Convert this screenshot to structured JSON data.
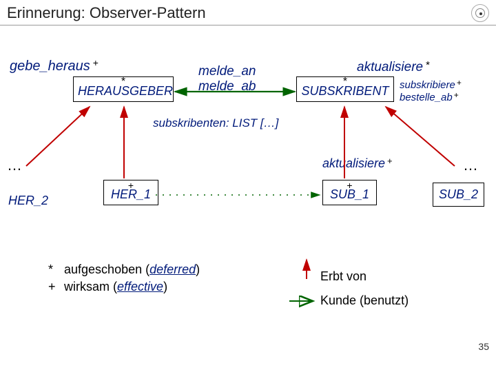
{
  "title": "Erinnerung: Observer-Pattern",
  "labels": {
    "gebe_heraus": "gebe_heraus",
    "melde_an": "melde_an",
    "melde_ab": "melde_ab",
    "aktualisiere_top": "aktualisiere",
    "subskribiere": "subskribiere",
    "bestelle_ab": "bestelle_ab",
    "subskribenten": "subskribenten: LIST […]",
    "aktualisiere_mid": "aktualisiere",
    "dots_left": "…",
    "dots_right": "…"
  },
  "classes": {
    "herausgeber": "HERAUSGEBER",
    "subskribent": "SUBSKRIBENT",
    "her1": "HER_1",
    "her2": "HER_2",
    "sub1": "SUB_1",
    "sub2": "SUB_2"
  },
  "marks": {
    "star": "*",
    "plus": "+"
  },
  "legend": {
    "deferred_label": "aufgeschoben (",
    "deferred_word": "deferred",
    "deferred_close": ")",
    "effective_label": "wirksam (",
    "effective_word": "effective",
    "effective_close": ")",
    "erbt_von": "Erbt von",
    "kunde": "Kunde (benutzt)"
  },
  "pagenum": "35"
}
